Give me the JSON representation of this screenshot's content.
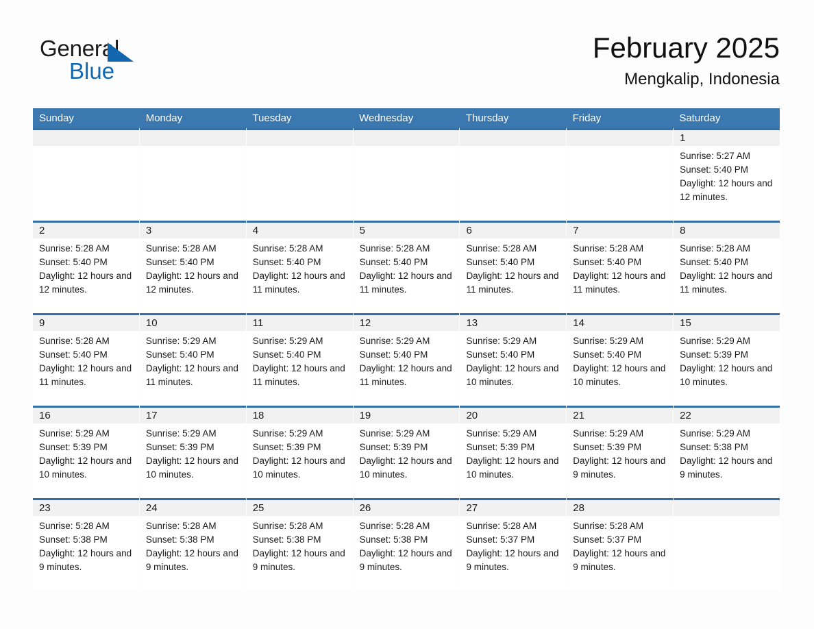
{
  "brand": {
    "name_part1": "General",
    "name_part2": "Blue",
    "triangle_icon": "blue-triangle-icon",
    "accent_color": "#1268ae"
  },
  "header": {
    "title": "February 2025",
    "location": "Mengkalip, Indonesia"
  },
  "theme": {
    "header_bar_color": "#3b78b0",
    "cell_top_border_color": "#2f6ea6",
    "daynum_band_color": "#f1f1f1",
    "page_background": "#fdfdfd"
  },
  "calendar": {
    "weekdays": [
      "Sunday",
      "Monday",
      "Tuesday",
      "Wednesday",
      "Thursday",
      "Friday",
      "Saturday"
    ],
    "weeks": [
      [
        {
          "day": "",
          "sunrise": "",
          "sunset": "",
          "daylight": ""
        },
        {
          "day": "",
          "sunrise": "",
          "sunset": "",
          "daylight": ""
        },
        {
          "day": "",
          "sunrise": "",
          "sunset": "",
          "daylight": ""
        },
        {
          "day": "",
          "sunrise": "",
          "sunset": "",
          "daylight": ""
        },
        {
          "day": "",
          "sunrise": "",
          "sunset": "",
          "daylight": ""
        },
        {
          "day": "",
          "sunrise": "",
          "sunset": "",
          "daylight": ""
        },
        {
          "day": "1",
          "sunrise": "Sunrise: 5:27 AM",
          "sunset": "Sunset: 5:40 PM",
          "daylight": "Daylight: 12 hours and 12 minutes."
        }
      ],
      [
        {
          "day": "2",
          "sunrise": "Sunrise: 5:28 AM",
          "sunset": "Sunset: 5:40 PM",
          "daylight": "Daylight: 12 hours and 12 minutes."
        },
        {
          "day": "3",
          "sunrise": "Sunrise: 5:28 AM",
          "sunset": "Sunset: 5:40 PM",
          "daylight": "Daylight: 12 hours and 12 minutes."
        },
        {
          "day": "4",
          "sunrise": "Sunrise: 5:28 AM",
          "sunset": "Sunset: 5:40 PM",
          "daylight": "Daylight: 12 hours and 11 minutes."
        },
        {
          "day": "5",
          "sunrise": "Sunrise: 5:28 AM",
          "sunset": "Sunset: 5:40 PM",
          "daylight": "Daylight: 12 hours and 11 minutes."
        },
        {
          "day": "6",
          "sunrise": "Sunrise: 5:28 AM",
          "sunset": "Sunset: 5:40 PM",
          "daylight": "Daylight: 12 hours and 11 minutes."
        },
        {
          "day": "7",
          "sunrise": "Sunrise: 5:28 AM",
          "sunset": "Sunset: 5:40 PM",
          "daylight": "Daylight: 12 hours and 11 minutes."
        },
        {
          "day": "8",
          "sunrise": "Sunrise: 5:28 AM",
          "sunset": "Sunset: 5:40 PM",
          "daylight": "Daylight: 12 hours and 11 minutes."
        }
      ],
      [
        {
          "day": "9",
          "sunrise": "Sunrise: 5:28 AM",
          "sunset": "Sunset: 5:40 PM",
          "daylight": "Daylight: 12 hours and 11 minutes."
        },
        {
          "day": "10",
          "sunrise": "Sunrise: 5:29 AM",
          "sunset": "Sunset: 5:40 PM",
          "daylight": "Daylight: 12 hours and 11 minutes."
        },
        {
          "day": "11",
          "sunrise": "Sunrise: 5:29 AM",
          "sunset": "Sunset: 5:40 PM",
          "daylight": "Daylight: 12 hours and 11 minutes."
        },
        {
          "day": "12",
          "sunrise": "Sunrise: 5:29 AM",
          "sunset": "Sunset: 5:40 PM",
          "daylight": "Daylight: 12 hours and 11 minutes."
        },
        {
          "day": "13",
          "sunrise": "Sunrise: 5:29 AM",
          "sunset": "Sunset: 5:40 PM",
          "daylight": "Daylight: 12 hours and 10 minutes."
        },
        {
          "day": "14",
          "sunrise": "Sunrise: 5:29 AM",
          "sunset": "Sunset: 5:40 PM",
          "daylight": "Daylight: 12 hours and 10 minutes."
        },
        {
          "day": "15",
          "sunrise": "Sunrise: 5:29 AM",
          "sunset": "Sunset: 5:39 PM",
          "daylight": "Daylight: 12 hours and 10 minutes."
        }
      ],
      [
        {
          "day": "16",
          "sunrise": "Sunrise: 5:29 AM",
          "sunset": "Sunset: 5:39 PM",
          "daylight": "Daylight: 12 hours and 10 minutes."
        },
        {
          "day": "17",
          "sunrise": "Sunrise: 5:29 AM",
          "sunset": "Sunset: 5:39 PM",
          "daylight": "Daylight: 12 hours and 10 minutes."
        },
        {
          "day": "18",
          "sunrise": "Sunrise: 5:29 AM",
          "sunset": "Sunset: 5:39 PM",
          "daylight": "Daylight: 12 hours and 10 minutes."
        },
        {
          "day": "19",
          "sunrise": "Sunrise: 5:29 AM",
          "sunset": "Sunset: 5:39 PM",
          "daylight": "Daylight: 12 hours and 10 minutes."
        },
        {
          "day": "20",
          "sunrise": "Sunrise: 5:29 AM",
          "sunset": "Sunset: 5:39 PM",
          "daylight": "Daylight: 12 hours and 10 minutes."
        },
        {
          "day": "21",
          "sunrise": "Sunrise: 5:29 AM",
          "sunset": "Sunset: 5:39 PM",
          "daylight": "Daylight: 12 hours and 9 minutes."
        },
        {
          "day": "22",
          "sunrise": "Sunrise: 5:29 AM",
          "sunset": "Sunset: 5:38 PM",
          "daylight": "Daylight: 12 hours and 9 minutes."
        }
      ],
      [
        {
          "day": "23",
          "sunrise": "Sunrise: 5:28 AM",
          "sunset": "Sunset: 5:38 PM",
          "daylight": "Daylight: 12 hours and 9 minutes."
        },
        {
          "day": "24",
          "sunrise": "Sunrise: 5:28 AM",
          "sunset": "Sunset: 5:38 PM",
          "daylight": "Daylight: 12 hours and 9 minutes."
        },
        {
          "day": "25",
          "sunrise": "Sunrise: 5:28 AM",
          "sunset": "Sunset: 5:38 PM",
          "daylight": "Daylight: 12 hours and 9 minutes."
        },
        {
          "day": "26",
          "sunrise": "Sunrise: 5:28 AM",
          "sunset": "Sunset: 5:38 PM",
          "daylight": "Daylight: 12 hours and 9 minutes."
        },
        {
          "day": "27",
          "sunrise": "Sunrise: 5:28 AM",
          "sunset": "Sunset: 5:37 PM",
          "daylight": "Daylight: 12 hours and 9 minutes."
        },
        {
          "day": "28",
          "sunrise": "Sunrise: 5:28 AM",
          "sunset": "Sunset: 5:37 PM",
          "daylight": "Daylight: 12 hours and 9 minutes."
        },
        {
          "day": "",
          "sunrise": "",
          "sunset": "",
          "daylight": ""
        }
      ]
    ]
  }
}
